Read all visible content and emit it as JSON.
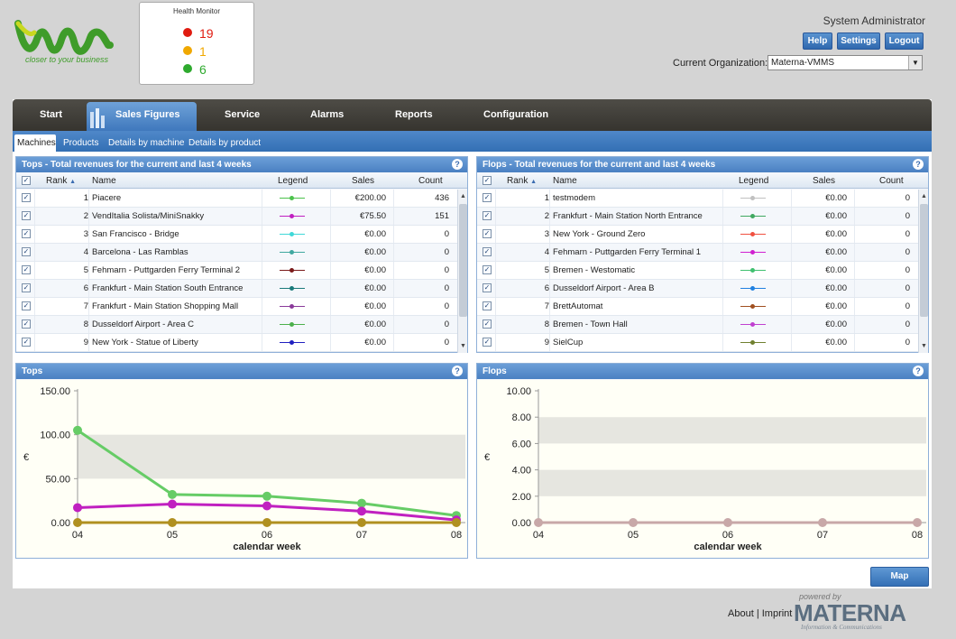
{
  "brand": {
    "tagline": "closer to your business"
  },
  "health_monitor": {
    "title": "Health Monitor",
    "counts": [
      {
        "value": "19",
        "color": "#e01b10"
      },
      {
        "value": "1",
        "color": "#f0a800"
      },
      {
        "value": "6",
        "color": "#2eaa2e"
      }
    ]
  },
  "user": {
    "name": "System Administrator",
    "help": "Help",
    "settings": "Settings",
    "logout": "Logout"
  },
  "org": {
    "label": "Current Organization:",
    "value": "Materna-VMMS"
  },
  "nav": {
    "tabs": [
      "Start",
      "Sales Figures",
      "Service",
      "Alarms",
      "Reports",
      "Configuration"
    ],
    "active": "Sales Figures"
  },
  "subnav": {
    "tabs": [
      "Machines",
      "Products",
      "Details by machine",
      "Details by product"
    ],
    "active": "Machines"
  },
  "tops_table": {
    "title": "Tops - Total revenues for the current and last 4 weeks",
    "columns": {
      "rank": "Rank",
      "name": "Name",
      "legend": "Legend",
      "sales": "Sales",
      "count": "Count"
    },
    "rows": [
      {
        "rank": "1",
        "name": "Piacere",
        "sales": "€200.00",
        "count": "436",
        "color": "#4cc24c"
      },
      {
        "rank": "2",
        "name": "VendItalia Solista/MiniSnakky",
        "sales": "€75.50",
        "count": "151",
        "color": "#c020c0"
      },
      {
        "rank": "3",
        "name": "San Francisco - Bridge",
        "sales": "€0.00",
        "count": "0",
        "color": "#40d8d8"
      },
      {
        "rank": "4",
        "name": "Barcelona - Las Ramblas",
        "sales": "€0.00",
        "count": "0",
        "color": "#40a8a0"
      },
      {
        "rank": "5",
        "name": "Fehmarn - Puttgarden Ferry Terminal 2",
        "sales": "€0.00",
        "count": "0",
        "color": "#7a1a1a"
      },
      {
        "rank": "6",
        "name": "Frankfurt - Main Station South Entrance",
        "sales": "€0.00",
        "count": "0",
        "color": "#1a7a7a"
      },
      {
        "rank": "7",
        "name": "Frankfurt - Main Station Shopping Mall",
        "sales": "€0.00",
        "count": "0",
        "color": "#8a3a9a"
      },
      {
        "rank": "8",
        "name": "Dusseldorf Airport - Area C",
        "sales": "€0.00",
        "count": "0",
        "color": "#4cb04c"
      },
      {
        "rank": "9",
        "name": "New York - Statue of Liberty",
        "sales": "€0.00",
        "count": "0",
        "color": "#2020c0"
      }
    ]
  },
  "flops_table": {
    "title": "Flops - Total revenues for the current and last 4 weeks",
    "columns": {
      "rank": "Rank",
      "name": "Name",
      "legend": "Legend",
      "sales": "Sales",
      "count": "Count"
    },
    "rows": [
      {
        "rank": "1",
        "name": "testmodem",
        "sales": "€0.00",
        "count": "0",
        "color": "#c0c0c0"
      },
      {
        "rank": "2",
        "name": "Frankfurt - Main Station North Entrance",
        "sales": "€0.00",
        "count": "0",
        "color": "#40a860"
      },
      {
        "rank": "3",
        "name": "New York - Ground Zero",
        "sales": "€0.00",
        "count": "0",
        "color": "#f05040"
      },
      {
        "rank": "4",
        "name": "Fehmarn - Puttgarden Ferry Terminal 1",
        "sales": "€0.00",
        "count": "0",
        "color": "#d020d0"
      },
      {
        "rank": "5",
        "name": "Bremen - Westomatic",
        "sales": "€0.00",
        "count": "0",
        "color": "#40c070"
      },
      {
        "rank": "6",
        "name": "Dusseldorf Airport - Area B",
        "sales": "€0.00",
        "count": "0",
        "color": "#2080e0"
      },
      {
        "rank": "7",
        "name": "BrettAutomat",
        "sales": "€0.00",
        "count": "0",
        "color": "#a05020"
      },
      {
        "rank": "8",
        "name": "Bremen - Town Hall",
        "sales": "€0.00",
        "count": "0",
        "color": "#c040d0"
      },
      {
        "rank": "9",
        "name": "SielCup",
        "sales": "€0.00",
        "count": "0",
        "color": "#708030"
      }
    ]
  },
  "chart_data": [
    {
      "type": "line",
      "title": "Tops",
      "xlabel": "calendar week",
      "ylabel": "€",
      "categories": [
        "04",
        "05",
        "06",
        "07",
        "08"
      ],
      "ylim": [
        0,
        150
      ],
      "yticks": [
        "0.00",
        "50.00",
        "100.00",
        "150.00"
      ],
      "series": [
        {
          "name": "Piacere",
          "color": "#66cc66",
          "values": [
            105,
            32,
            30,
            22,
            8
          ]
        },
        {
          "name": "VendItalia Solista/MiniSnakky",
          "color": "#c020c0",
          "values": [
            17,
            21,
            19,
            13,
            3
          ]
        },
        {
          "color": "#b09020",
          "values": [
            0,
            0,
            0,
            0,
            0
          ]
        }
      ]
    },
    {
      "type": "line",
      "title": "Flops",
      "xlabel": "calendar week",
      "ylabel": "€",
      "categories": [
        "04",
        "05",
        "06",
        "07",
        "08"
      ],
      "ylim": [
        0,
        10
      ],
      "yticks": [
        "0.00",
        "2.00",
        "4.00",
        "6.00",
        "8.00",
        "10.00"
      ],
      "series": [
        {
          "color": "#c8a8a8",
          "values": [
            0,
            0,
            0,
            0,
            0
          ]
        }
      ]
    }
  ],
  "map_button": "Map",
  "footer": {
    "powered": "powered by",
    "about": "About",
    "sep": "|",
    "imprint": "Imprint",
    "company": "MATERNA",
    "company_sub": "Information & Communications"
  }
}
